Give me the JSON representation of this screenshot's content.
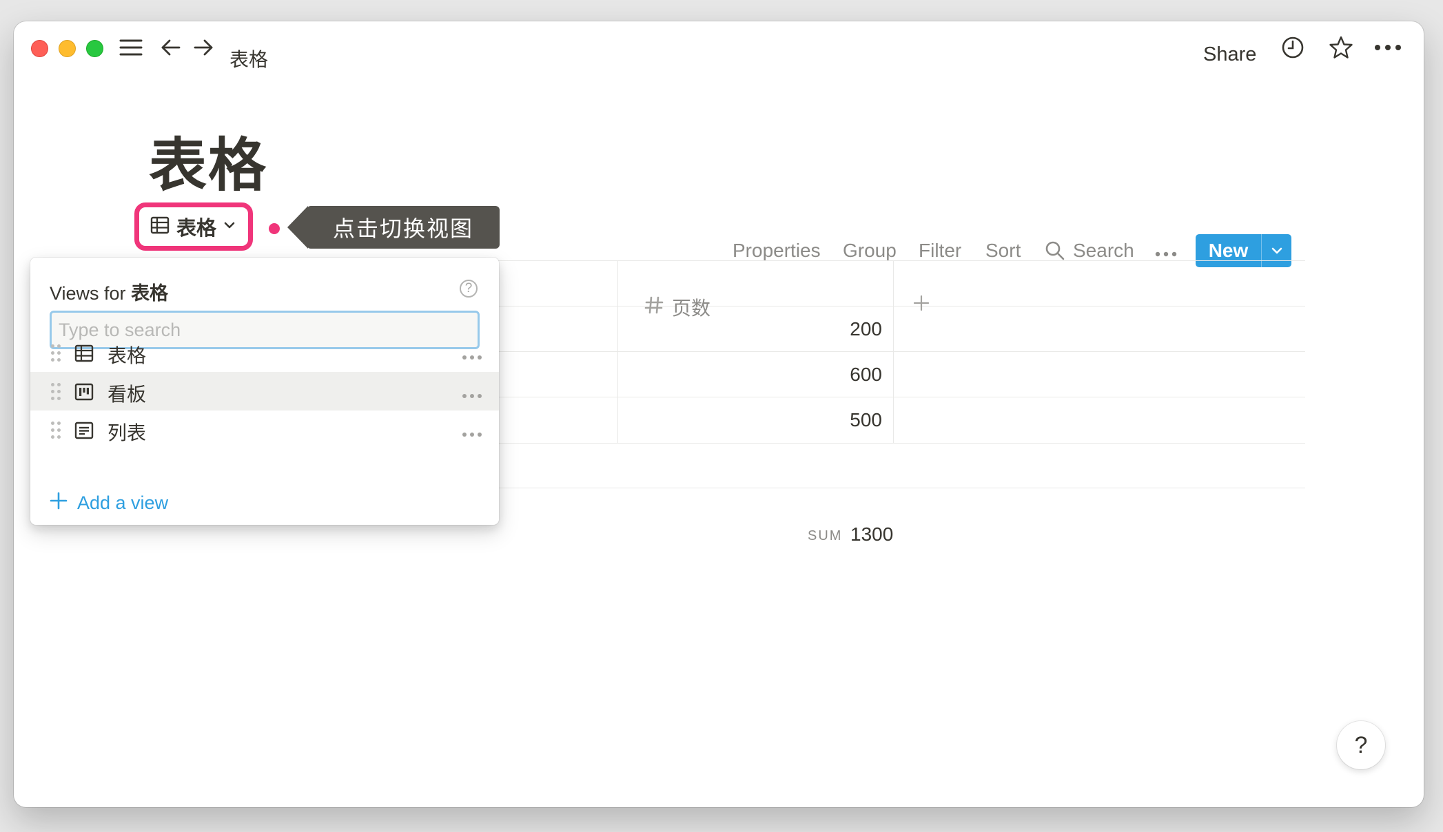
{
  "topbar": {
    "breadcrumb": "表格",
    "share_label": "Share"
  },
  "page": {
    "title": "表格"
  },
  "view_switcher": {
    "current_view": "表格"
  },
  "callout": {
    "text": "点击切换视图"
  },
  "toolbar": {
    "properties": "Properties",
    "group": "Group",
    "filter": "Filter",
    "sort": "Sort",
    "search": "Search",
    "new": "New"
  },
  "table": {
    "column": {
      "name": "页数",
      "type_icon": "number-hash-icon"
    },
    "rows": [
      "200",
      "600",
      "500"
    ],
    "sum_label": "SUM",
    "sum_value": "1300"
  },
  "views_menu": {
    "title_prefix": "Views for",
    "title_name": "表格",
    "search_placeholder": "Type to search",
    "help_glyph": "?",
    "views": [
      {
        "label": "表格",
        "icon": "table-view-icon"
      },
      {
        "label": "看板",
        "icon": "board-view-icon"
      },
      {
        "label": "列表",
        "icon": "list-view-icon"
      }
    ],
    "hovered_index": 1,
    "add_view": "Add a view"
  },
  "help_button": "?",
  "colors": {
    "accent": "#2e9fe0",
    "highlight": "#f0357a",
    "text": "#37352f",
    "muted": "#8c8b88",
    "callout_bg": "#55534e"
  }
}
